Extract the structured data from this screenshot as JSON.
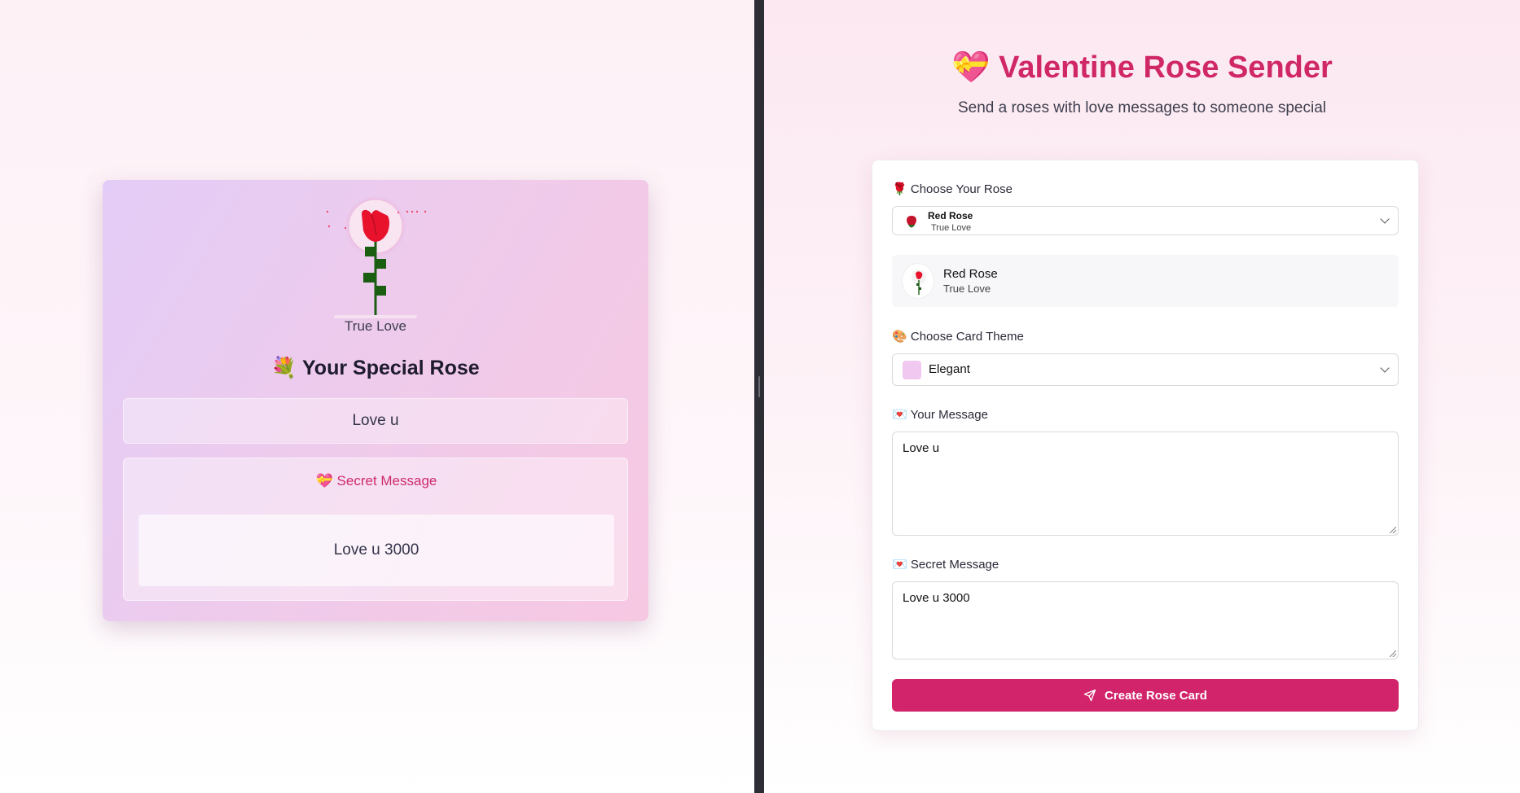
{
  "card": {
    "rose_meaning": "True Love",
    "title_emoji": "💐",
    "title": "Your Special Rose",
    "message": "Love u",
    "secret_emoji": "💝",
    "secret_title": "Secret Message",
    "secret_message": "Love u 3000"
  },
  "header": {
    "title_emoji": "💝",
    "title": "Valentine Rose Sender",
    "subtitle": "Send a roses with love messages to someone special"
  },
  "form": {
    "rose_label_emoji": "🌹",
    "rose_label": "Choose Your Rose",
    "rose_select": {
      "name": "Red Rose",
      "meaning": "True Love"
    },
    "preview": {
      "name": "Red Rose",
      "meaning": "True Love"
    },
    "theme_label_emoji": "🎨",
    "theme_label": "Choose Card Theme",
    "theme_select": {
      "value": "Elegant",
      "swatch_color": "#f1c8ef"
    },
    "message_label_emoji": "💌",
    "message_label": "Your Message",
    "message_value": "Love u",
    "secret_label_emoji": "💌",
    "secret_label": "Secret Message",
    "secret_value": "Love u 3000",
    "submit_label": "Create Rose Card"
  },
  "colors": {
    "accent": "#d1246a",
    "title_pink": "#d02767",
    "rose_red": "#e8122d",
    "stem_green": "#1a5e12"
  }
}
